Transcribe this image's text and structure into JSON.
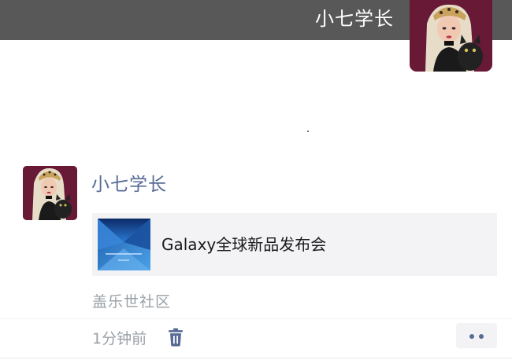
{
  "cover": {
    "username": "小七学长"
  },
  "post": {
    "author": "小七学长",
    "share_card": {
      "title": "Galaxy全球新品发布会"
    },
    "source": "盖乐世社区",
    "time": "1分钟前"
  },
  "icons": {
    "delete": "trash-icon",
    "more": "more-dots-icon"
  },
  "colors": {
    "cover_bar": "#585858",
    "author_link": "#576b95",
    "meta_text": "#9aa0a6",
    "card_bg": "#f3f3f5"
  }
}
